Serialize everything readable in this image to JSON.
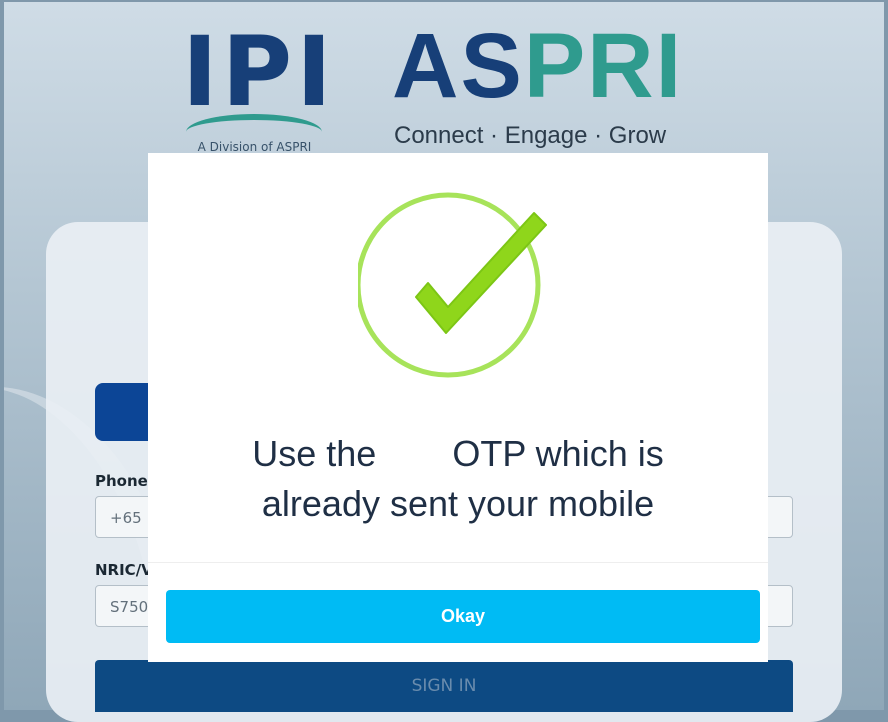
{
  "brand": {
    "ipi_logo_text": "IPI",
    "ipi_subtitle": "A Division of ASPRI",
    "aspri_logo_text_a": "AS",
    "aspri_logo_text_b": "PRI",
    "aspri_tagline": "Connect · Engage · Grow"
  },
  "login": {
    "phone_label": "Phone",
    "phone_value": "+65",
    "nric_label": "NRIC/V",
    "nric_value": "S750",
    "signin_label": "SIGN IN"
  },
  "modal": {
    "icon": "checkmark-success-icon",
    "message_part1": "Use the",
    "message_part2": "OTP which is",
    "message_part3": "already sent your mobile",
    "okay_label": "Okay"
  },
  "colors": {
    "check_green": "#8fd61b",
    "okay_blue": "#00bbf4",
    "brand_navy": "#173f78",
    "brand_teal": "#2f9b8e"
  }
}
